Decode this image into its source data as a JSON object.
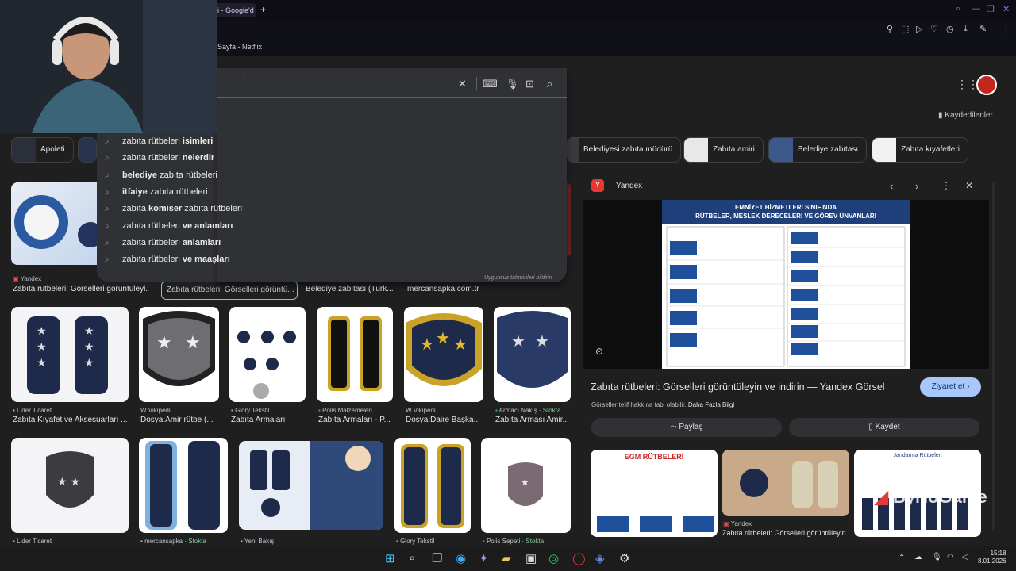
{
  "browser": {
    "active_tab": "i - Google'd",
    "new_tab": "+",
    "bookmark": "Sayfa - Netflix"
  },
  "search": {
    "suggestions": [
      {
        "prefix": "zabıta rütbeleri ",
        "bold": "isimleri",
        "suffix": ""
      },
      {
        "prefix": "zabıta rütbeleri ",
        "bold": "nelerdir",
        "suffix": ""
      },
      {
        "prefix": "",
        "bold": "belediye",
        "suffix": " zabıta rütbeleri"
      },
      {
        "prefix": "",
        "bold": "itfaiye",
        "suffix": " zabıta rütbeleri"
      },
      {
        "prefix": "zabıta ",
        "bold": "komiser",
        "suffix": " zabıta rütbeleri"
      },
      {
        "prefix": "zabıta rütbeleri ",
        "bold": "ve anlamları",
        "suffix": ""
      },
      {
        "prefix": "zabıta rütbeleri ",
        "bold": "anlamları",
        "suffix": ""
      },
      {
        "prefix": "zabıta rütbeleri ",
        "bold": "ve maaşları",
        "suffix": ""
      }
    ],
    "report": "Uygunsuz tahminleri bildirin"
  },
  "header": {
    "saved": "Kaydedilenler"
  },
  "chips": [
    "Apoleti",
    "Belediyesi zabıta müdürü",
    "Zabıta amiri",
    "Belediye zabıtası",
    "Zabıta kıyafetleri"
  ],
  "results": {
    "row1": [
      {
        "source": "Yandex",
        "title": "Zabıta rütbeleri: Görselleri görüntüleyi..."
      },
      {
        "source": "",
        "title": "Zabıta rütbeleri: Görselleri görüntü..."
      },
      {
        "source": "",
        "title": "Belediye zabıtası (Türk..."
      },
      {
        "source": "",
        "title": "mercansapka.com.tr"
      }
    ],
    "row2": [
      {
        "source": "Lider Ticaret",
        "title": "Zabıta Kıyafet ve Aksesuarları ..."
      },
      {
        "source": "Vikipedi",
        "title": "Dosya:Amir rütbe (..."
      },
      {
        "source": "Glory Tekstil",
        "title": "Zabıta Armaları"
      },
      {
        "source": "Polis Malzemeleri",
        "title": "Zabıta Armaları - P..."
      },
      {
        "source": "Vikipedi",
        "title": "Dosya:Daire Başka..."
      },
      {
        "source": "Armacı Nakış",
        "stock": "Stokta",
        "title": "Zabıta Arması Amir..."
      }
    ],
    "row3": [
      {
        "source": "Lider Ticaret"
      },
      {
        "source": "mercansapka",
        "stock": "Stokta"
      },
      {
        "source": "Yeni Bakış"
      },
      {
        "source": "Glory Tekstil"
      },
      {
        "source": "Polis Sepeti",
        "stock": "Stokta"
      }
    ]
  },
  "side_panel": {
    "source": "Yandex",
    "doc_title_1": "EMNİYET HİZMETLERİ SINIFINDA",
    "doc_title_2": "RÜTBELER, MESLEK DERECELERİ VE GÖREV ÜNVANLARI",
    "title": "Zabıta rütbeleri: Görselleri görüntüleyin ve indirin — Yandex Görsel",
    "visit": "Ziyaret et",
    "copyright": "Görseller telif hakkına tabi olabilir.",
    "more_info": "Daha Fazla Bilgi",
    "share": "Paylaş",
    "save": "Kaydet",
    "related_source": "Yandex",
    "related_title": "Zabıta rütbeleri: Görselleri görüntüleyin",
    "related_egm": "EGM RÜTBELERİ",
    "related_jandarma": "Jandarma Rütbeleri"
  },
  "watermark": "ByNoGame",
  "taskbar": {
    "time": "15:18",
    "date": "8.01.2026"
  },
  "colors": {
    "page_bg": "#1f1f1f",
    "suggestion_bg": "#303134",
    "visit_button": "#a8c7fa",
    "accent_purple": "#7e7ae8"
  }
}
